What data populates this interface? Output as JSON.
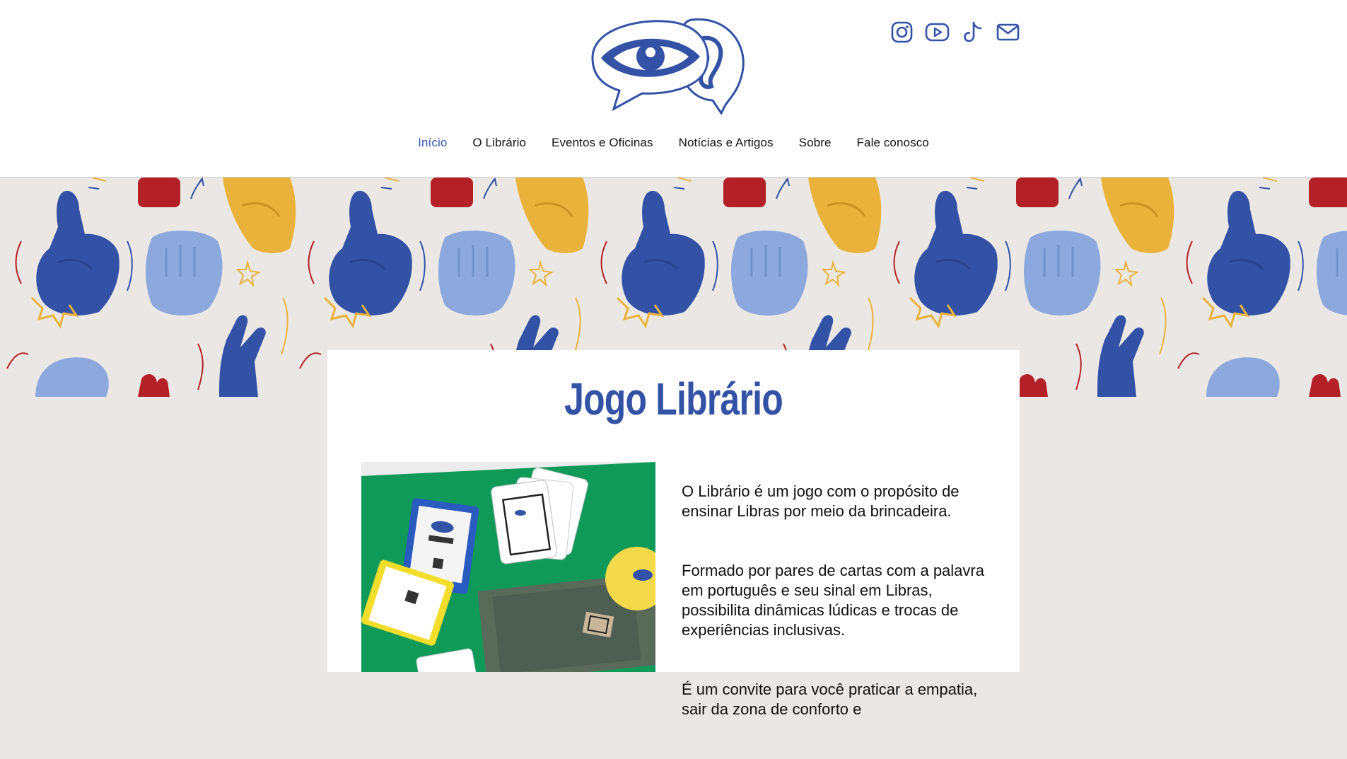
{
  "header": {
    "logo_alt": "Librário logo",
    "social": [
      {
        "name": "instagram-icon"
      },
      {
        "name": "youtube-icon"
      },
      {
        "name": "tiktok-icon"
      },
      {
        "name": "email-icon"
      }
    ]
  },
  "nav": {
    "items": [
      {
        "label": "Início",
        "active": true
      },
      {
        "label": "O Librário",
        "active": false
      },
      {
        "label": "Eventos e Oficinas",
        "active": false
      },
      {
        "label": "Notícias e Artigos",
        "active": false
      },
      {
        "label": "Sobre",
        "active": false
      },
      {
        "label": "Fale conosco",
        "active": false
      }
    ]
  },
  "main": {
    "title": "Jogo Librário",
    "paragraphs": [
      "O Librário é um jogo com o propósito de ensinar Libras por meio da brincadeira.",
      "Formado por pares de cartas com a palavra em português e seu sinal em Libras, possibilita dinâmicas lúdicas e trocas de experiências inclusivas.",
      "É um convite para você praticar a empatia, sair da zona de conforto e"
    ]
  },
  "colors": {
    "brand_blue": "#3352a6",
    "light_blue": "#8ca8dc",
    "yellow": "#e9b23a",
    "red": "#b42028",
    "background": "#ebe7e4",
    "table_green": "#0f9a5a"
  }
}
